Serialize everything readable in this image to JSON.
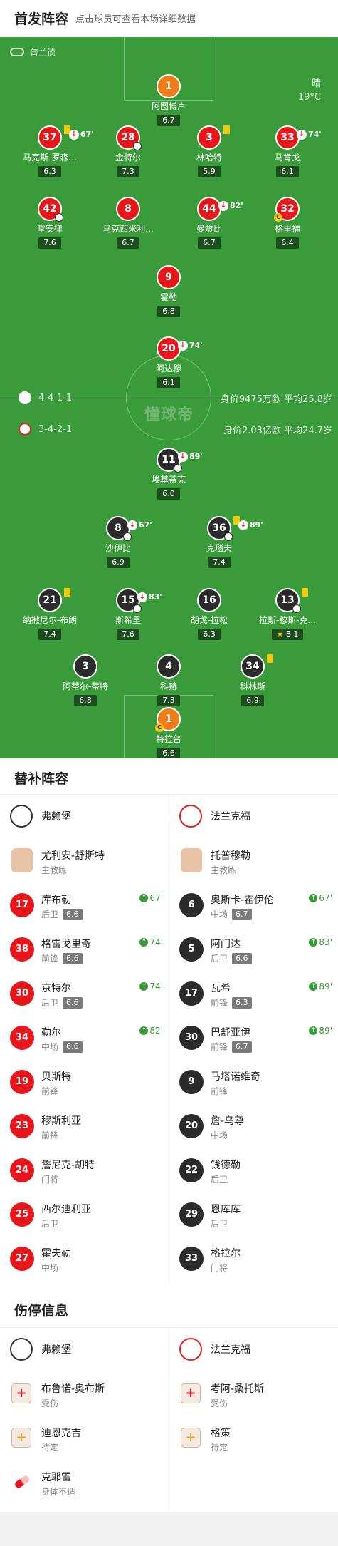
{
  "header": {
    "title": "首发阵容",
    "subtitle": "点击球员可查看本场详细数据"
  },
  "pitch": {
    "referee": "普兰德",
    "weather": {
      "cond": "晴",
      "temp": "19°C"
    },
    "watermark": "懂球帝",
    "home": {
      "formation": "4-4-1-1",
      "stats": "身价9475万欧 平均25.8岁"
    },
    "away": {
      "formation": "3-4-2-1",
      "stats": "身价2.03亿欧 平均24.7岁"
    },
    "home_players": [
      {
        "num": "1",
        "name": "阿图博卢",
        "rating": "6.7"
      },
      {
        "num": "37",
        "name": "马克斯-罗森...",
        "rating": "6.3",
        "sub": "67'"
      },
      {
        "num": "28",
        "name": "金特尔",
        "rating": "7.3"
      },
      {
        "num": "3",
        "name": "林哈特",
        "rating": "5.9"
      },
      {
        "num": "33",
        "name": "马肯戈",
        "rating": "6.1",
        "sub": "74'"
      },
      {
        "num": "42",
        "name": "堂安律",
        "rating": "7.6"
      },
      {
        "num": "8",
        "name": "马克西米利...",
        "rating": "6.7"
      },
      {
        "num": "44",
        "name": "曼赞比",
        "rating": "6.7",
        "sub": "82'"
      },
      {
        "num": "32",
        "name": "格里福",
        "rating": "6.4"
      },
      {
        "num": "9",
        "name": "霍勒",
        "rating": "6.8"
      },
      {
        "num": "20",
        "name": "阿达穆",
        "rating": "6.1",
        "sub": "74'"
      }
    ],
    "away_players": [
      {
        "num": "11",
        "name": "埃基蒂克",
        "rating": "6.0",
        "sub": "89'"
      },
      {
        "num": "8",
        "name": "沙伊比",
        "rating": "6.9",
        "sub": "67'"
      },
      {
        "num": "36",
        "name": "克瑙夫",
        "rating": "7.4",
        "sub": "89'"
      },
      {
        "num": "21",
        "name": "纳撒尼尔-布朗",
        "rating": "7.4"
      },
      {
        "num": "15",
        "name": "斯希里",
        "rating": "7.6",
        "sub": "83'"
      },
      {
        "num": "16",
        "name": "胡戈-拉松",
        "rating": "6.3"
      },
      {
        "num": "13",
        "name": "拉斯-穆斯-克...",
        "rating": "8.1"
      },
      {
        "num": "3",
        "name": "阿蒂尔-蒂特",
        "rating": "6.8"
      },
      {
        "num": "4",
        "name": "科赫",
        "rating": "7.3"
      },
      {
        "num": "34",
        "name": "科林斯",
        "rating": "6.9"
      },
      {
        "num": "1",
        "name": "特拉普",
        "rating": "6.6"
      }
    ]
  },
  "subs": {
    "title": "替补阵容",
    "home_club": "弗赖堡",
    "away_club": "法兰克福",
    "home_coach": {
      "name": "尤利安-舒斯特",
      "role": "主教练"
    },
    "away_coach": {
      "name": "托普穆勒",
      "role": "主教练"
    },
    "home": [
      {
        "num": "17",
        "name": "库布勒",
        "pos": "后卫",
        "rating": "6.6",
        "time": "67'"
      },
      {
        "num": "38",
        "name": "格雷戈里奇",
        "pos": "前锋",
        "rating": "6.6",
        "time": "74'"
      },
      {
        "num": "30",
        "name": "京特尔",
        "pos": "后卫",
        "rating": "6.6",
        "time": "74'"
      },
      {
        "num": "34",
        "name": "勒尔",
        "pos": "中场",
        "rating": "6.6",
        "time": "82'"
      },
      {
        "num": "19",
        "name": "贝斯特",
        "pos": "前锋"
      },
      {
        "num": "23",
        "name": "穆斯利亚",
        "pos": "前锋"
      },
      {
        "num": "24",
        "name": "詹尼克-胡特",
        "pos": "门将"
      },
      {
        "num": "25",
        "name": "西尔迪利亚",
        "pos": "后卫"
      },
      {
        "num": "27",
        "name": "霍夫勒",
        "pos": "中场"
      }
    ],
    "away": [
      {
        "num": "6",
        "name": "奥斯卡-霍伊伦",
        "pos": "中场",
        "rating": "6.7",
        "time": "67'"
      },
      {
        "num": "5",
        "name": "阿门达",
        "pos": "后卫",
        "rating": "6.6",
        "time": "83'"
      },
      {
        "num": "17",
        "name": "瓦希",
        "pos": "前锋",
        "rating": "6.3",
        "time": "89'"
      },
      {
        "num": "30",
        "name": "巴舒亚伊",
        "pos": "前锋",
        "rating": "6.7",
        "time": "89'"
      },
      {
        "num": "9",
        "name": "马塔诺维奇",
        "pos": "前锋"
      },
      {
        "num": "20",
        "name": "詹-乌尊",
        "pos": "中场"
      },
      {
        "num": "22",
        "name": "钱德勒",
        "pos": "后卫"
      },
      {
        "num": "29",
        "name": "恩库库",
        "pos": "后卫"
      },
      {
        "num": "33",
        "name": "格拉尔",
        "pos": "门将"
      }
    ]
  },
  "injuries": {
    "title": "伤停信息",
    "home_club": "弗赖堡",
    "away_club": "法兰克福",
    "home": [
      {
        "name": "布鲁诺-奥布斯",
        "status": "受伤"
      },
      {
        "name": "迪恩克吉",
        "status": "待定"
      },
      {
        "name": "克耶雷",
        "status": "身体不适"
      }
    ],
    "away": [
      {
        "name": "考阿-桑托斯",
        "status": "受伤"
      },
      {
        "name": "格策",
        "status": "待定"
      }
    ]
  }
}
